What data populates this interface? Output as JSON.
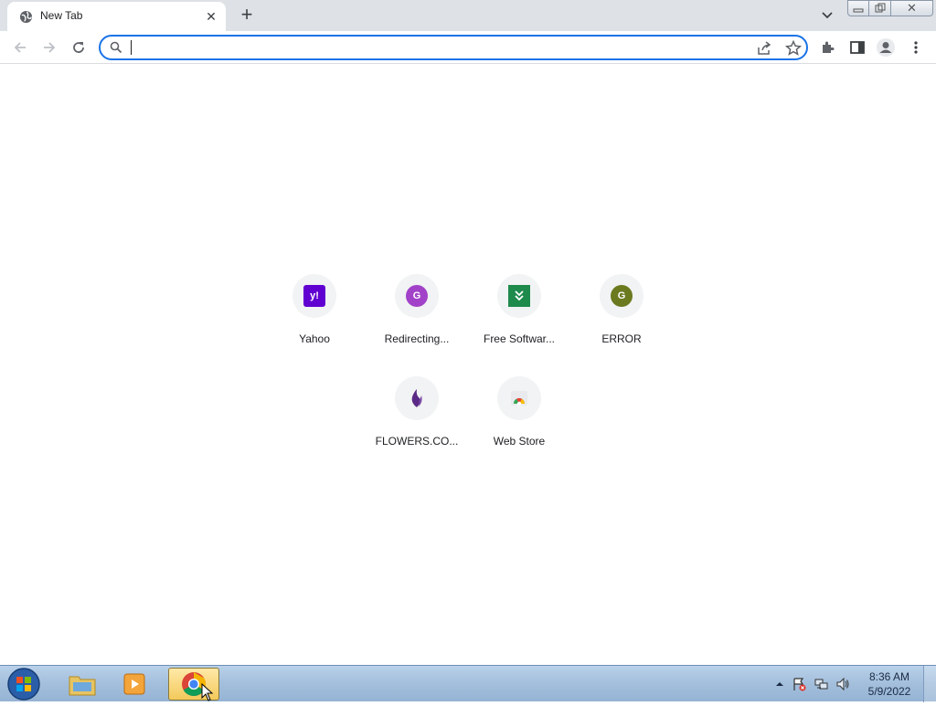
{
  "tab": {
    "title": "New Tab",
    "close_glyph": "✕"
  },
  "tabstrip": {
    "new_tab_glyph": "+"
  },
  "window": {
    "close_glyph": "✕"
  },
  "omnibox": {
    "value": "",
    "placeholder": ""
  },
  "shortcuts": [
    {
      "title": "Yahoo",
      "icon": "yahoo-icon",
      "icon_text": "y!",
      "color": "#6001d2"
    },
    {
      "title": "Redirecting...",
      "icon": "letter-g-icon",
      "icon_text": "G",
      "color": "#a142c8"
    },
    {
      "title": "Free Softwar...",
      "icon": "download-icon",
      "icon_text": "»",
      "color": "#1e8a4c"
    },
    {
      "title": "ERROR",
      "icon": "letter-g-icon",
      "icon_text": "G",
      "color": "#6b7a1f"
    },
    {
      "title": "FLOWERS.CO...",
      "icon": "flower-icon",
      "icon_text": "",
      "color": "#5b2a86"
    },
    {
      "title": "Web Store",
      "icon": "webstore-icon",
      "icon_text": "",
      "color": "#4285f4"
    }
  ],
  "taskbar": {
    "apps": [
      "explorer-icon",
      "media-player-icon",
      "chrome-icon"
    ],
    "clock_time": "8:36 AM",
    "clock_date": "5/9/2022"
  }
}
